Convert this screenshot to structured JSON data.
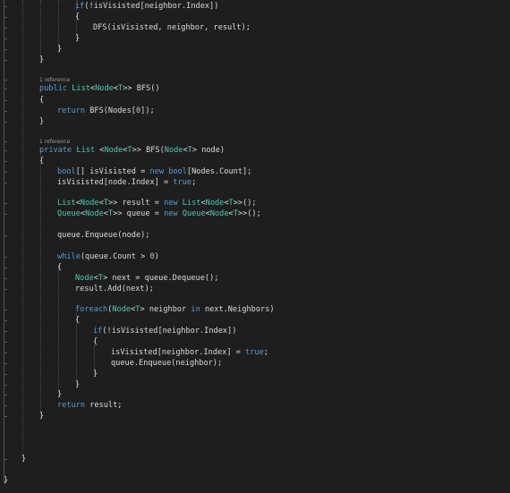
{
  "editor": {
    "colors": {
      "background": "#1e1e1e",
      "keyword": "#569cd6",
      "type": "#4ec9b0",
      "number": "#b5cea8",
      "text": "#dcdcdc",
      "codelens": "#9a9a9a"
    },
    "lines": [
      [
        {
          "t": "if",
          "k": "kw"
        },
        {
          "t": "(!isVisisted[neighbor.Index])",
          "k": "tx"
        }
      ],
      [
        {
          "t": "{",
          "k": "tx"
        }
      ],
      [
        {
          "t": "DFS(isVisisted, neighbor, result);",
          "k": "tx"
        }
      ],
      [
        {
          "t": "}",
          "k": "tx"
        }
      ],
      [
        {
          "t": "}",
          "k": "tx"
        }
      ],
      [
        {
          "t": "}",
          "k": "tx"
        }
      ],
      [
        {
          "t": "1 reference",
          "k": "ref"
        }
      ],
      [
        {
          "t": "public ",
          "k": "kw"
        },
        {
          "t": "List",
          "k": "ty"
        },
        {
          "t": "<",
          "k": "tx"
        },
        {
          "t": "Node",
          "k": "ty"
        },
        {
          "t": "<",
          "k": "tx"
        },
        {
          "t": "T",
          "k": "ty"
        },
        {
          "t": ">> BFS()",
          "k": "tx"
        }
      ],
      [
        {
          "t": "{",
          "k": "tx"
        }
      ],
      [
        {
          "t": "return ",
          "k": "kw"
        },
        {
          "t": "BFS(Nodes[",
          "k": "tx"
        },
        {
          "t": "0",
          "k": "num"
        },
        {
          "t": "]);",
          "k": "tx"
        }
      ],
      [
        {
          "t": "}",
          "k": "tx"
        }
      ],
      [
        {
          "t": "1 reference",
          "k": "ref"
        }
      ],
      [
        {
          "t": "private ",
          "k": "kw"
        },
        {
          "t": "List ",
          "k": "ty"
        },
        {
          "t": "<",
          "k": "tx"
        },
        {
          "t": "Node",
          "k": "ty"
        },
        {
          "t": "<",
          "k": "tx"
        },
        {
          "t": "T",
          "k": "ty"
        },
        {
          "t": ">> BFS(",
          "k": "tx"
        },
        {
          "t": "Node",
          "k": "ty"
        },
        {
          "t": "<",
          "k": "tx"
        },
        {
          "t": "T",
          "k": "ty"
        },
        {
          "t": "> node)",
          "k": "tx"
        }
      ],
      [
        {
          "t": "{",
          "k": "tx"
        }
      ],
      [
        {
          "t": "bool",
          "k": "kw"
        },
        {
          "t": "[] isVisisted = ",
          "k": "tx"
        },
        {
          "t": "new ",
          "k": "kw"
        },
        {
          "t": "bool",
          "k": "kw"
        },
        {
          "t": "[Nodes.Count];",
          "k": "tx"
        }
      ],
      [
        {
          "t": "isVisisted[node.Index] = ",
          "k": "tx"
        },
        {
          "t": "true",
          "k": "kw"
        },
        {
          "t": ";",
          "k": "tx"
        }
      ],
      [
        {
          "t": "List",
          "k": "ty"
        },
        {
          "t": "<",
          "k": "tx"
        },
        {
          "t": "Node",
          "k": "ty"
        },
        {
          "t": "<",
          "k": "tx"
        },
        {
          "t": "T",
          "k": "ty"
        },
        {
          "t": ">> result = ",
          "k": "tx"
        },
        {
          "t": "new ",
          "k": "kw"
        },
        {
          "t": "List",
          "k": "ty"
        },
        {
          "t": "<",
          "k": "tx"
        },
        {
          "t": "Node",
          "k": "ty"
        },
        {
          "t": "<",
          "k": "tx"
        },
        {
          "t": "T",
          "k": "ty"
        },
        {
          "t": ">>();",
          "k": "tx"
        }
      ],
      [
        {
          "t": "Queue",
          "k": "ty"
        },
        {
          "t": "<",
          "k": "tx"
        },
        {
          "t": "Node",
          "k": "ty"
        },
        {
          "t": "<",
          "k": "tx"
        },
        {
          "t": "T",
          "k": "ty"
        },
        {
          "t": ">> queue = ",
          "k": "tx"
        },
        {
          "t": "new ",
          "k": "kw"
        },
        {
          "t": "Queue",
          "k": "ty"
        },
        {
          "t": "<",
          "k": "tx"
        },
        {
          "t": "Node",
          "k": "ty"
        },
        {
          "t": "<",
          "k": "tx"
        },
        {
          "t": "T",
          "k": "ty"
        },
        {
          "t": ">>();",
          "k": "tx"
        }
      ],
      [
        {
          "t": "queue.Enqueue(node);",
          "k": "tx"
        }
      ],
      [
        {
          "t": "while",
          "k": "kw"
        },
        {
          "t": "(queue.Count > ",
          "k": "tx"
        },
        {
          "t": "0",
          "k": "num"
        },
        {
          "t": ")",
          "k": "tx"
        }
      ],
      [
        {
          "t": "{",
          "k": "tx"
        }
      ],
      [
        {
          "t": "Node",
          "k": "ty"
        },
        {
          "t": "<",
          "k": "tx"
        },
        {
          "t": "T",
          "k": "ty"
        },
        {
          "t": "> next = queue.Dequeue();",
          "k": "tx"
        }
      ],
      [
        {
          "t": "result.Add(next);",
          "k": "tx"
        }
      ],
      [
        {
          "t": "foreach",
          "k": "kw"
        },
        {
          "t": "(",
          "k": "tx"
        },
        {
          "t": "Node",
          "k": "ty"
        },
        {
          "t": "<",
          "k": "tx"
        },
        {
          "t": "T",
          "k": "ty"
        },
        {
          "t": "> neighbor ",
          "k": "tx"
        },
        {
          "t": "in ",
          "k": "kw"
        },
        {
          "t": "next.Neighbors)",
          "k": "tx"
        }
      ],
      [
        {
          "t": "{",
          "k": "tx"
        }
      ],
      [
        {
          "t": "if",
          "k": "kw"
        },
        {
          "t": "(!isVisisted[neighbor.Index])",
          "k": "tx"
        }
      ],
      [
        {
          "t": "{",
          "k": "tx"
        }
      ],
      [
        {
          "t": "isVisisted[neighbor.Index] = ",
          "k": "tx"
        },
        {
          "t": "true",
          "k": "kw"
        },
        {
          "t": ";",
          "k": "tx"
        }
      ],
      [
        {
          "t": "queue.Enqueue(neighbor);",
          "k": "tx"
        }
      ],
      [
        {
          "t": "}",
          "k": "tx"
        }
      ],
      [
        {
          "t": "}",
          "k": "tx"
        }
      ],
      [
        {
          "t": "}",
          "k": "tx"
        }
      ],
      [
        {
          "t": "return ",
          "k": "kw"
        },
        {
          "t": "result;",
          "k": "tx"
        }
      ],
      [
        {
          "t": "}",
          "k": "tx"
        }
      ],
      [
        {
          "t": "}",
          "k": "tx"
        }
      ],
      [
        {
          "t": "}",
          "k": "tx"
        }
      ]
    ]
  }
}
